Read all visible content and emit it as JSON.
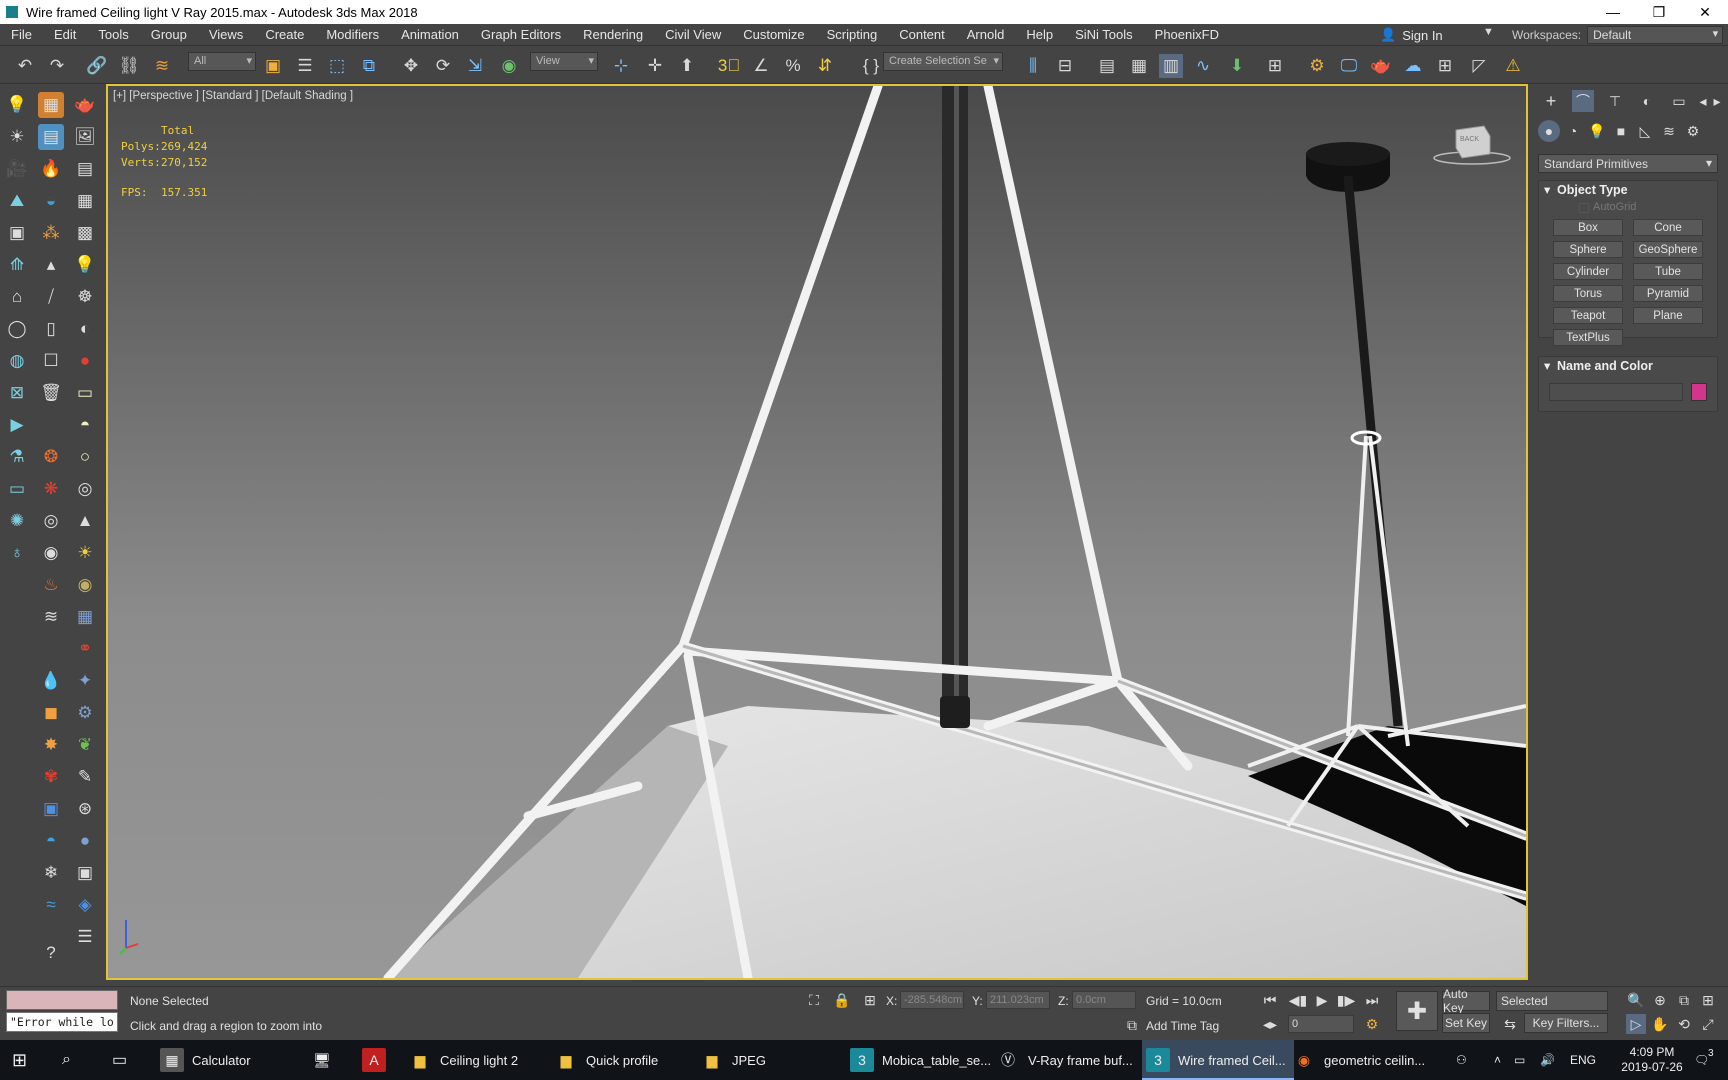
{
  "window": {
    "title": "Wire framed Ceiling light V Ray 2015.max - Autodesk 3ds Max 2018"
  },
  "menu": [
    "File",
    "Edit",
    "Tools",
    "Group",
    "Views",
    "Create",
    "Modifiers",
    "Animation",
    "Graph Editors",
    "Rendering",
    "Civil View",
    "Customize",
    "Scripting",
    "Content",
    "Arnold",
    "Help",
    "SiNi Tools",
    "PhoenixFD"
  ],
  "header": {
    "sign_in": "Sign In",
    "workspaces_label": "Workspaces:",
    "workspace_value": "Default"
  },
  "toolbar": {
    "selection_filter": "All",
    "ref_coord": "View",
    "named_selection": "Create Selection Se"
  },
  "viewport": {
    "label": "[+] [Perspective ] [Standard ] [Default Shading ]",
    "stats": {
      "total_label": "Total",
      "polys_label": "Polys:",
      "polys_value": "269,424",
      "verts_label": "Verts:",
      "verts_value": "270,152",
      "fps_label": "FPS:",
      "fps_value": "157.351"
    },
    "viewcube_label": "BACK"
  },
  "command_panel": {
    "category": "Standard Primitives",
    "object_type_title": "Object Type",
    "autogrid": "AutoGrid",
    "primitives": [
      "Box",
      "Cone",
      "Sphere",
      "GeoSphere",
      "Cylinder",
      "Tube",
      "Torus",
      "Pyramid",
      "Teapot",
      "Plane",
      "TextPlus"
    ],
    "name_color_title": "Name and Color",
    "object_color": "#d4348c"
  },
  "status": {
    "maxscript_output": "\"Error while lo",
    "selection": "None Selected",
    "prompt": "Click and drag a region to zoom into",
    "x_label": "X:",
    "x_value": "-285.548cm",
    "y_label": "Y:",
    "y_value": "211.023cm",
    "z_label": "Z:",
    "z_value": "0.0cm",
    "grid": "Grid = 10.0cm",
    "add_time_tag": "Add Time Tag",
    "frame": "0",
    "auto_key": "Auto Key",
    "set_key": "Set Key",
    "key_set": "Selected",
    "key_filters": "Key Filters..."
  },
  "taskbar": {
    "items": [
      "Calculator",
      "Ceiling light 2",
      "Quick profile",
      "JPEG",
      "Mobica_table_se...",
      "V-Ray frame buf...",
      "Wire framed Ceil...",
      "geometric ceilin..."
    ],
    "lang": "ENG",
    "time": "4:09 PM",
    "date": "2019-07-26",
    "notifications": "3"
  }
}
